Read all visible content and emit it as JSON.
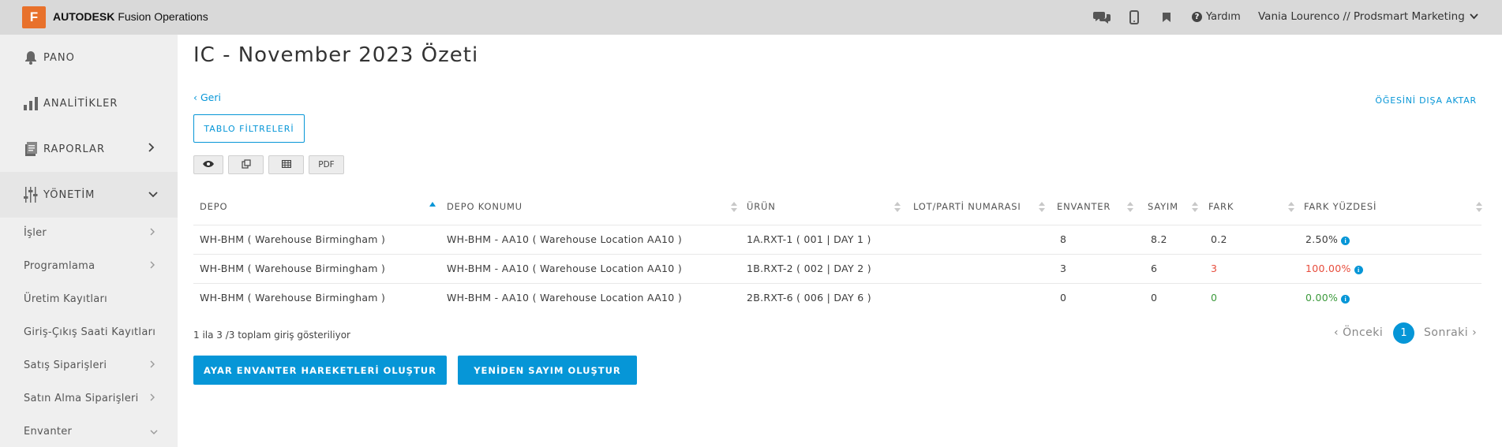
{
  "header": {
    "logo_letter": "F",
    "brand_bold": "AUTODESK",
    "brand_product": "Fusion Operations",
    "help_label": "Yardım",
    "user_label": "Vania Lourenco // Prodsmart Marketing",
    "icons": [
      "chat-icon",
      "mobile-icon",
      "bookmark-icon",
      "help-icon",
      "chevron-down-icon"
    ]
  },
  "sidebar": {
    "main_items": [
      {
        "label": "PANO",
        "icon": "bell-icon"
      },
      {
        "label": "ANALİTİKLER",
        "icon": "bar-chart-icon"
      },
      {
        "label": "RAPORLAR",
        "icon": "report-icon"
      },
      {
        "label": "YÖNETİM",
        "icon": "sliders-icon"
      }
    ],
    "sub_items": [
      {
        "label": "İşler"
      },
      {
        "label": "Programlama"
      },
      {
        "label": "Üretim Kayıtları"
      },
      {
        "label": "Giriş-Çıkış Saati Kayıtları"
      },
      {
        "label": "Satış Siparişleri"
      },
      {
        "label": "Satın Alma Siparişleri"
      },
      {
        "label": "Envanter"
      }
    ]
  },
  "page": {
    "title": "IC - November 2023 Özeti",
    "back_label": "Geri",
    "export_label": "ÖĞESİNİ DIŞA AKTAR",
    "filter_label": "TABLO FİLTRELERİ",
    "tool_pdf_label": "PDF"
  },
  "table": {
    "headers": [
      "DEPO",
      "DEPO KONUMU",
      "ÜRÜN",
      "LOT/PARTİ NUMARASI",
      "ENVANTER",
      "SAYIM",
      "FARK",
      "FARK YÜZDESİ"
    ],
    "rows": [
      {
        "depo": "WH-BHM ( Warehouse Birmingham )",
        "konum": "WH-BHM - AA10 ( Warehouse Location AA10 )",
        "urun": "1A.RXT-1 ( 001 | DAY 1 )",
        "lot": "",
        "envanter": "8",
        "sayim": "8.2",
        "fark": "0.2",
        "yuzde": "2.50%",
        "status": "neutral"
      },
      {
        "depo": "WH-BHM ( Warehouse Birmingham )",
        "konum": "WH-BHM - AA10 ( Warehouse Location AA10 )",
        "urun": "1B.RXT-2 ( 002 | DAY 2 )",
        "lot": "",
        "envanter": "3",
        "sayim": "6",
        "fark": "3",
        "yuzde": "100.00%",
        "status": "red"
      },
      {
        "depo": "WH-BHM ( Warehouse Birmingham )",
        "konum": "WH-BHM - AA10 ( Warehouse Location AA10 )",
        "urun": "2B.RXT-6 ( 006 | DAY 6 )",
        "lot": "",
        "envanter": "0",
        "sayim": "0",
        "fark": "0",
        "yuzde": "0.00%",
        "status": "green"
      }
    ],
    "summary": "1 ila 3 /3 toplam giriş gösteriliyor"
  },
  "pagination": {
    "prev_label": "Önceki",
    "current_page": "1",
    "next_label": "Sonraki"
  },
  "actions": {
    "adjust_label": "AYAR ENVANTER HAREKETLERİ OLUŞTUR",
    "recount_label": "YENİDEN SAYIM OLUŞTUR"
  },
  "colors": {
    "accent": "#0696d7",
    "brand_orange": "#e8712b",
    "negative": "#e74c3c",
    "positive": "#3c9a3c"
  }
}
